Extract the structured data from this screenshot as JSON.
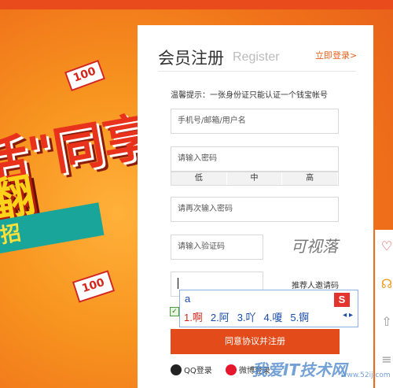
{
  "banner": {
    "line1": "活\"同享",
    "line2": "翻",
    "ribbon": "招",
    "bill1": "100",
    "bill2": "100"
  },
  "panel": {
    "title": "会员注册",
    "subtitle": "Register",
    "login_link": "立即登录>",
    "hint": "温馨提示：一张身份证只能认证一个钱宝帐号"
  },
  "form": {
    "username_placeholder": "手机号/邮箱/用户名",
    "password_placeholder": "请输入密码",
    "strength": [
      "低",
      "中",
      "高"
    ],
    "confirm_placeholder": "请再次输入密码",
    "captcha_placeholder": "请输入验证码",
    "captcha_text": "可视落",
    "referrer_label": "推荐人邀请码",
    "submit_label": "同意协议并注册",
    "qq_login": "QQ登录",
    "weibo_login": "微博登录"
  },
  "ime": {
    "input": "a",
    "candidates": [
      "1.啊",
      "2.阿",
      "3.吖",
      "4.嗄",
      "5.锕"
    ],
    "arrows": "◂ ▸"
  },
  "watermark": {
    "text": "我爱IT技术网",
    "url": "www.52ij.com"
  }
}
